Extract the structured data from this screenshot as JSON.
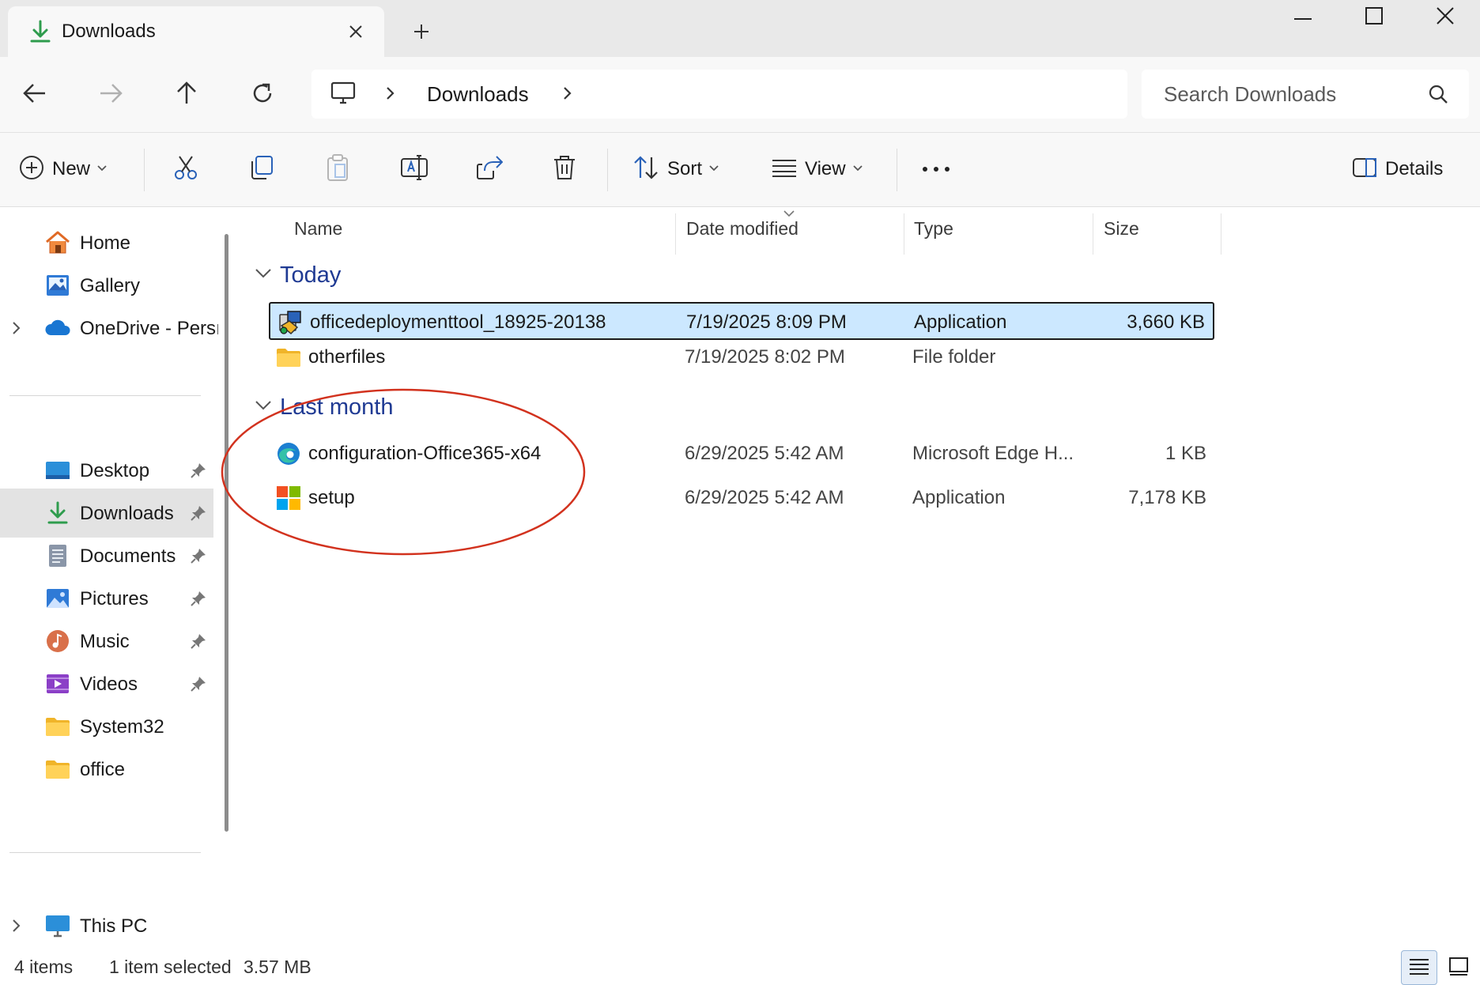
{
  "window": {
    "tab_title": "Downloads",
    "tab_icon": "download-icon",
    "minimize_icon": "minimize-icon",
    "maximize_icon": "maximize-icon",
    "close_icon": "close-icon"
  },
  "address_bar": {
    "location_icon": "monitor-icon",
    "breadcrumb": [
      "Downloads"
    ],
    "search_placeholder": "Search Downloads"
  },
  "command_bar": {
    "new_label": "New",
    "sort_label": "Sort",
    "view_label": "View",
    "details_label": "Details",
    "icons": [
      "new-icon",
      "cut-icon",
      "copy-icon",
      "paste-icon",
      "rename-icon",
      "share-icon",
      "delete-icon",
      "sort-icon",
      "view-icon",
      "more-icon",
      "details-pane-icon"
    ]
  },
  "sidebar": {
    "items": [
      {
        "label": "Home",
        "icon": "home-icon"
      },
      {
        "label": "Gallery",
        "icon": "gallery-icon"
      },
      {
        "label": "OneDrive - Persı",
        "icon": "cloud-icon"
      },
      {
        "label": "Desktop",
        "icon": "desktop-icon",
        "pinned": true
      },
      {
        "label": "Downloads",
        "icon": "download-icon",
        "pinned": true,
        "selected": true
      },
      {
        "label": "Documents",
        "icon": "document-icon",
        "pinned": true
      },
      {
        "label": "Pictures",
        "icon": "pictures-icon",
        "pinned": true
      },
      {
        "label": "Music",
        "icon": "music-icon",
        "pinned": true
      },
      {
        "label": "Videos",
        "icon": "videos-icon",
        "pinned": true
      },
      {
        "label": "System32",
        "icon": "folder-icon"
      },
      {
        "label": "office",
        "icon": "folder-icon"
      },
      {
        "label": "This PC",
        "icon": "this-pc-icon"
      }
    ]
  },
  "columns": {
    "name": "Name",
    "date_modified": "Date modified",
    "type": "Type",
    "size": "Size"
  },
  "groups": [
    {
      "label": "Today",
      "files": [
        {
          "name": "officedeploymenttool_18925-20138",
          "date": "7/19/2025 8:09 PM",
          "type": "Application",
          "size": "3,660 KB",
          "icon": "installer-icon",
          "selected": true
        },
        {
          "name": "otherfiles",
          "date": "7/19/2025 8:02 PM",
          "type": "File folder",
          "size": "",
          "icon": "folder-icon"
        }
      ]
    },
    {
      "label": "Last month",
      "files": [
        {
          "name": "configuration-Office365-x64",
          "date": "6/29/2025 5:42 AM",
          "type": "Microsoft Edge H...",
          "size": "1 KB",
          "icon": "edge-icon"
        },
        {
          "name": "setup",
          "date": "6/29/2025 5:42 AM",
          "type": "Application",
          "size": "7,178 KB",
          "icon": "windows-logo-icon"
        }
      ]
    }
  ],
  "status": {
    "item_count": "4 items",
    "selection": "1 item selected",
    "selection_size": "3.57 MB"
  },
  "colors": {
    "selected_row": "#cce8ff",
    "group_header": "#1f3a93",
    "annotation_ellipse": "#d2321e"
  }
}
